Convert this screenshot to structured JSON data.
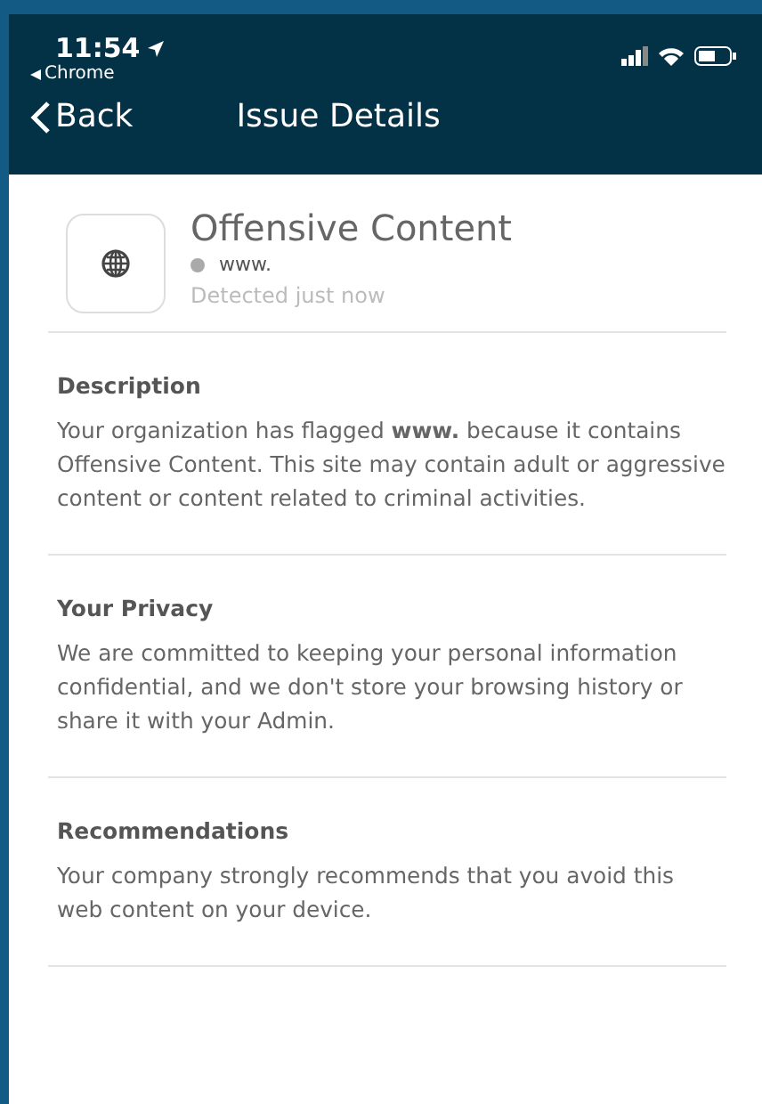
{
  "status_bar": {
    "time": "11:54",
    "back_app": "Chrome"
  },
  "nav": {
    "back": "Back",
    "title": "Issue Details"
  },
  "issue": {
    "title": "Offensive Content",
    "site": "www.",
    "detected": "Detected just now"
  },
  "sections": [
    {
      "heading": "Description",
      "body": "Your organization has flagged **www.** because it contains Offensive Content. This site may contain adult or aggressive content or content related to criminal activities."
    },
    {
      "heading": "Your Privacy",
      "body": "We are committed to keeping your personal information confidential, and we don't store your browsing history or share it with your Admin."
    },
    {
      "heading": "Recommendations",
      "body": "Your company strongly recommends that you avoid this web content on your device."
    }
  ]
}
